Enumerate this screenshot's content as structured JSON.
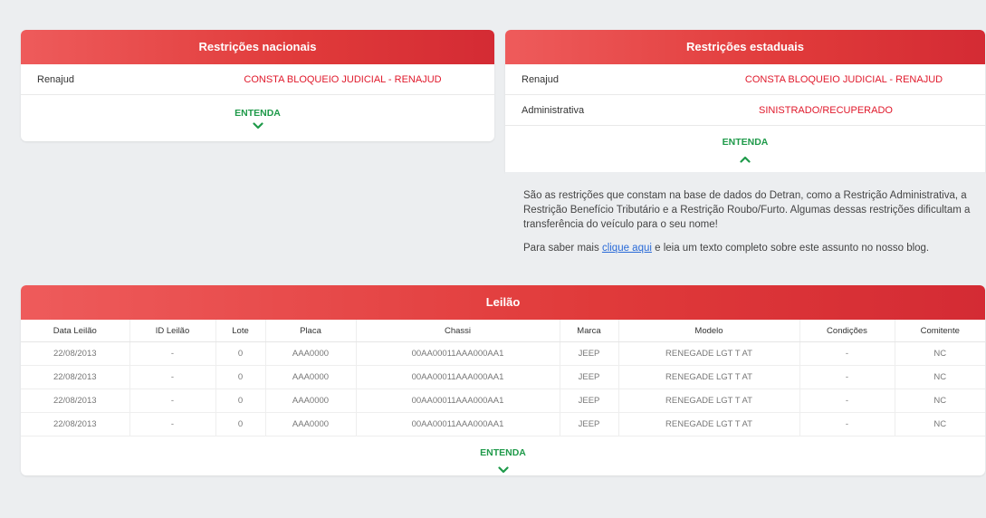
{
  "nacional": {
    "title": "Restrições nacionais",
    "rows": [
      {
        "label": "Renajud",
        "value": "CONSTA BLOQUEIO JUDICIAL - RENAJUD"
      }
    ],
    "entenda": "ENTENDA"
  },
  "estadual": {
    "title": "Restrições estaduais",
    "rows": [
      {
        "label": "Renajud",
        "value": "CONSTA BLOQUEIO JUDICIAL - RENAJUD"
      },
      {
        "label": "Administrativa",
        "value": "SINISTRADO/RECUPERADO"
      }
    ],
    "entenda": "ENTENDA",
    "info_p1": "São as restrições que constam na base de dados do Detran, como a Restrição Administrativa, a Restrição Benefício Tributário e a Restrição Roubo/Furto. Algumas dessas restrições dificultam a transferência do veículo para o seu nome!",
    "info_p2_before": "Para saber mais ",
    "info_link": "clique aqui",
    "info_p2_after": " e leia um texto completo sobre este assunto no nosso blog."
  },
  "leilao": {
    "title": "Leilão",
    "columns": [
      "Data Leilão",
      "ID Leilão",
      "Lote",
      "Placa",
      "Chassi",
      "Marca",
      "Modelo",
      "Condições",
      "Comitente"
    ],
    "rows": [
      [
        "22/08/2013",
        "-",
        "0",
        "AAA0000",
        "00AA00011AAA000AA1",
        "JEEP",
        "RENEGADE LGT T AT",
        "-",
        "NC"
      ],
      [
        "22/08/2013",
        "-",
        "0",
        "AAA0000",
        "00AA00011AAA000AA1",
        "JEEP",
        "RENEGADE LGT T AT",
        "-",
        "NC"
      ],
      [
        "22/08/2013",
        "-",
        "0",
        "AAA0000",
        "00AA00011AAA000AA1",
        "JEEP",
        "RENEGADE LGT T AT",
        "-",
        "NC"
      ],
      [
        "22/08/2013",
        "-",
        "0",
        "AAA0000",
        "00AA00011AAA000AA1",
        "JEEP",
        "RENEGADE LGT T AT",
        "-",
        "NC"
      ]
    ],
    "entenda": "ENTENDA"
  },
  "colors": {
    "header_red": "#e03a3a",
    "value_red": "#e0192b",
    "entenda_green": "#1f9a4a",
    "link_blue": "#2a6bd8"
  }
}
